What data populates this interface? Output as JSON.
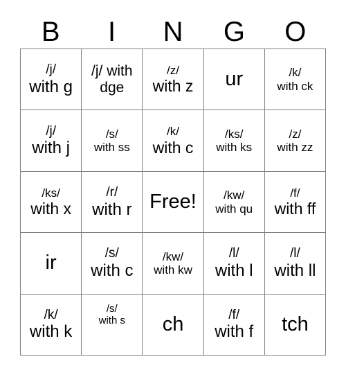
{
  "card": {
    "title_letters": [
      "B",
      "I",
      "N",
      "G",
      "O"
    ],
    "free_space_label": "Free!",
    "rows": [
      [
        {
          "top": "/j/",
          "bottom": "with g"
        },
        {
          "top": "/j/ with",
          "bottom": "dge"
        },
        {
          "top": "/z/",
          "bottom": "with z"
        },
        {
          "top": "",
          "bottom": "ur"
        },
        {
          "top": "/k/",
          "bottom": "with ck"
        }
      ],
      [
        {
          "top": "/j/",
          "bottom": "with j"
        },
        {
          "top": "/s/",
          "bottom": "with ss"
        },
        {
          "top": "/k/",
          "bottom": "with c"
        },
        {
          "top": "/ks/",
          "bottom": "with ks"
        },
        {
          "top": "/z/",
          "bottom": "with zz"
        }
      ],
      [
        {
          "top": "/ks/",
          "bottom": "with x"
        },
        {
          "top": "/r/",
          "bottom": "with r"
        },
        {
          "top": "",
          "bottom": "Free!"
        },
        {
          "top": "/kw/",
          "bottom": "with qu"
        },
        {
          "top": "/f/",
          "bottom": "with ff"
        }
      ],
      [
        {
          "top": "",
          "bottom": "ir"
        },
        {
          "top": "/s/",
          "bottom": "with c"
        },
        {
          "top": "/kw/",
          "bottom": "with kw"
        },
        {
          "top": "/l/",
          "bottom": "with l"
        },
        {
          "top": "/l/",
          "bottom": "with ll"
        }
      ],
      [
        {
          "top": "/k/",
          "bottom": "with k"
        },
        {
          "top": "/s/",
          "bottom": "with s"
        },
        {
          "top": "",
          "bottom": "ch"
        },
        {
          "top": "/f/",
          "bottom": "with f"
        },
        {
          "top": "",
          "bottom": "tch"
        }
      ]
    ]
  },
  "colors": {
    "border": "#808080",
    "text": "#000000",
    "background": "#ffffff"
  }
}
